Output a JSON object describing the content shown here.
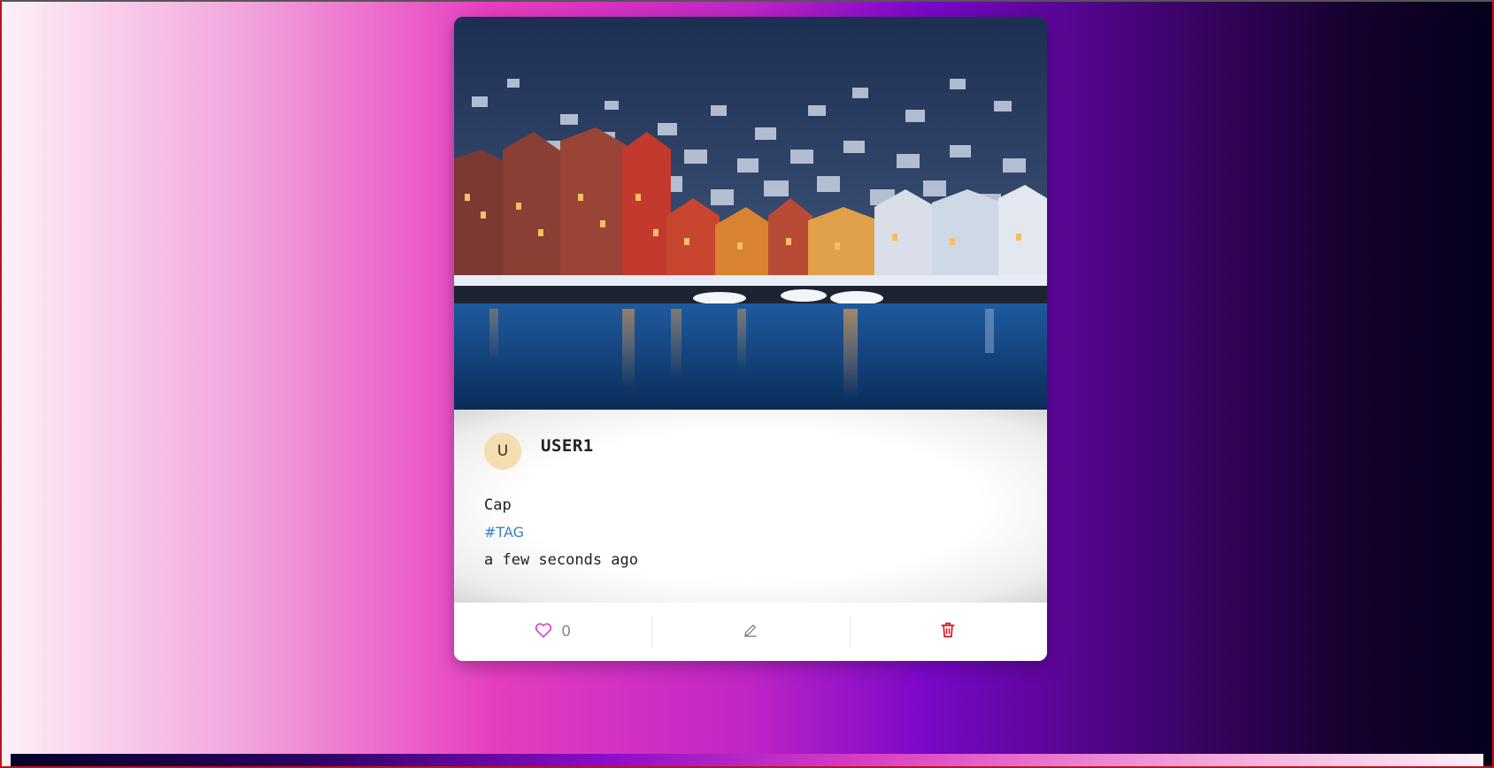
{
  "post": {
    "avatar_initial": "U",
    "username": "USER1",
    "caption": "Cap",
    "tag": "#TAG",
    "timestamp": "a few seconds ago",
    "photo_alt": "Snowy harbor town with colorful houses at dusk"
  },
  "actions": {
    "like_count": "0",
    "like_icon": "heart-icon",
    "edit_icon": "pencil-icon",
    "delete_icon": "trash-icon"
  },
  "colors": {
    "like": "#e23bd0",
    "edit": "#777777",
    "delete": "#d8141e",
    "tag": "#3b7fc4",
    "avatar_bg": "#f4ddb0"
  }
}
